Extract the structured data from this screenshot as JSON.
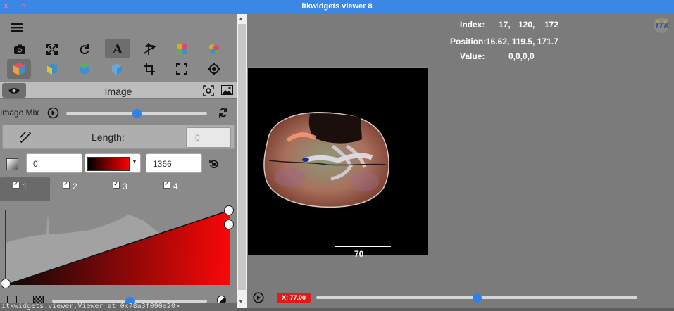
{
  "window": {
    "title": "itkwidgets viewer 8",
    "controls": [
      "x",
      "—",
      "≈"
    ]
  },
  "toolbar": {
    "row1": [
      "screenshot-icon",
      "fullscreen-icon",
      "rotate-icon",
      "annotations-icon",
      "axes-icon",
      "interpolation-icon",
      "shadow-icon"
    ],
    "row2": [
      "view-volume-icon",
      "view-x-plane-icon",
      "view-y-plane-icon",
      "view-z-plane-icon",
      "crop-icon",
      "reset-crop-icon",
      "reset-camera-icon"
    ]
  },
  "layer": {
    "label": "Image"
  },
  "image_mix": {
    "label": "Image Mix",
    "value": 0.5
  },
  "length": {
    "label": "Length:",
    "value": "0"
  },
  "colormap": {
    "min": "0",
    "max": "1366",
    "preset": "red"
  },
  "components": [
    {
      "label": "1",
      "checked": true,
      "active": true
    },
    {
      "label": "2",
      "checked": true,
      "active": false
    },
    {
      "label": "3",
      "checked": true,
      "active": false
    },
    {
      "label": "4",
      "checked": true,
      "active": false
    }
  ],
  "opacity": {
    "value": 0.5
  },
  "viewer": {
    "index_label": "Index:",
    "index_values": [
      "17,",
      "120,",
      "172"
    ],
    "position_label": "Position:",
    "position_values": "16.62, 119.5, 171.7",
    "value_label": "Value:",
    "value_values": "0,0,0,0",
    "scale_label": "70",
    "slice_badge": "X: 77.00",
    "slice_value": 0.5
  },
  "console": {
    "text": "itkwidgets.viewer.Viewer at 0x78a3f090e20>"
  },
  "colors": {
    "accent": "#2f82ec",
    "titlebar": "#3b87e6",
    "badge": "#e11a1a"
  }
}
